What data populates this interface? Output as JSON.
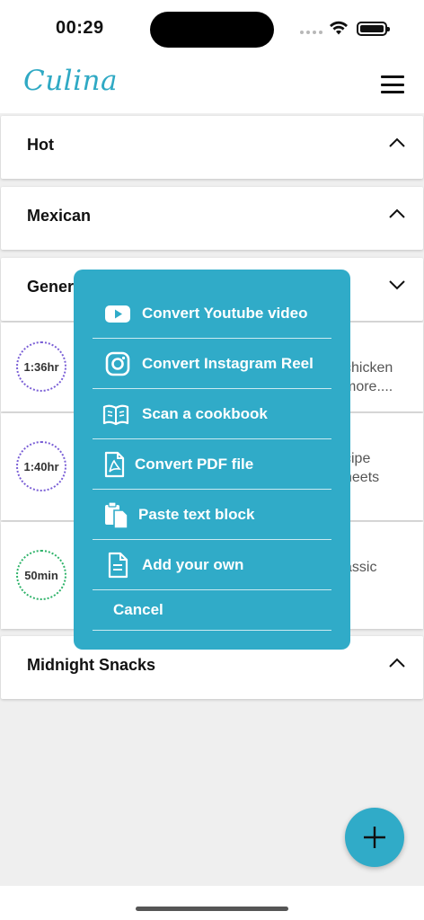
{
  "status_bar": {
    "time": "00:29"
  },
  "header": {
    "logo": "Culina"
  },
  "categories": [
    {
      "title": "Hot",
      "chevron": "chevron-up-icon"
    },
    {
      "title": "Mexican",
      "chevron": "chevron-up-icon"
    },
    {
      "title": "Gener",
      "chevron": "chevron-down-icon"
    },
    {
      "title": "Midnight Snacks",
      "chevron": "chevron-up-icon"
    }
  ],
  "recipes": [
    {
      "time": "1:36hr",
      "text_line1": "chicken",
      "text_line2": "more....",
      "ring_color": "#7a5fd6"
    },
    {
      "time": "1:40hr",
      "text_line1": "cipe",
      "text_line2": "heets",
      "ring_color": "#7a5fd6"
    },
    {
      "time": "50min",
      "text_line1": "assic",
      "text_line2": "",
      "ring_color": "#2fb36a"
    }
  ],
  "popup": {
    "items": [
      {
        "label": "Convert Youtube video",
        "icon": "youtube-icon"
      },
      {
        "label": "Convert Instagram Reel",
        "icon": "instagram-icon"
      },
      {
        "label": "Scan a cookbook",
        "icon": "book-icon"
      },
      {
        "label": "Convert PDF file",
        "icon": "pdf-icon"
      },
      {
        "label": "Paste text block",
        "icon": "paste-icon"
      },
      {
        "label": "Add your own",
        "icon": "document-icon"
      }
    ],
    "cancel": "Cancel"
  },
  "colors": {
    "accent": "#30abc8",
    "background": "#efefef"
  }
}
